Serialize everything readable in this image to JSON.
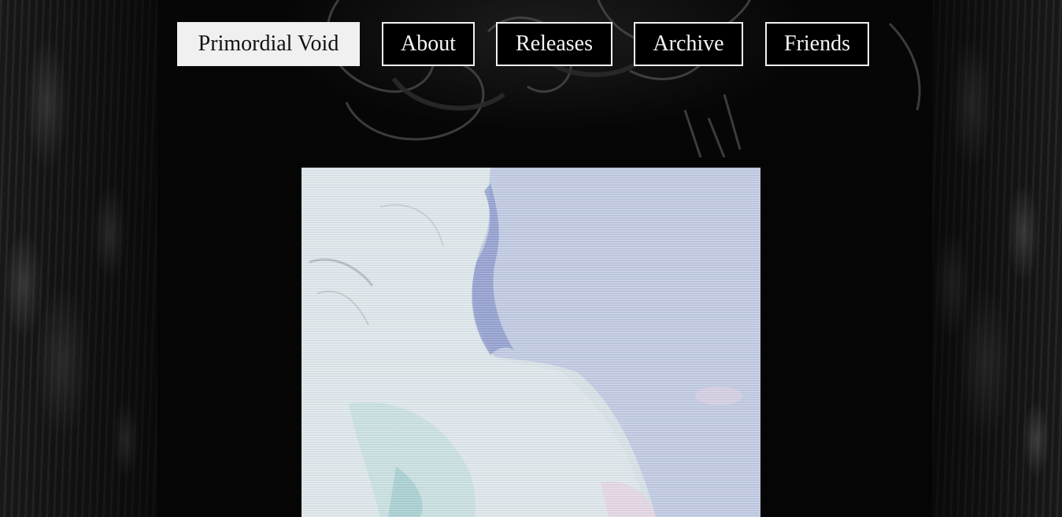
{
  "nav": {
    "items": [
      {
        "label": "Primordial Void",
        "active": true
      },
      {
        "label": "About",
        "active": false
      },
      {
        "label": "Releases",
        "active": false
      },
      {
        "label": "Archive",
        "active": false
      },
      {
        "label": "Friends",
        "active": false
      }
    ]
  },
  "colors": {
    "background": "#000000",
    "nav_border": "#f2f2f2",
    "nav_active_bg": "#f0f0f0",
    "hero_light": "#e3ecef",
    "hero_blue": "#a9b3d6"
  }
}
